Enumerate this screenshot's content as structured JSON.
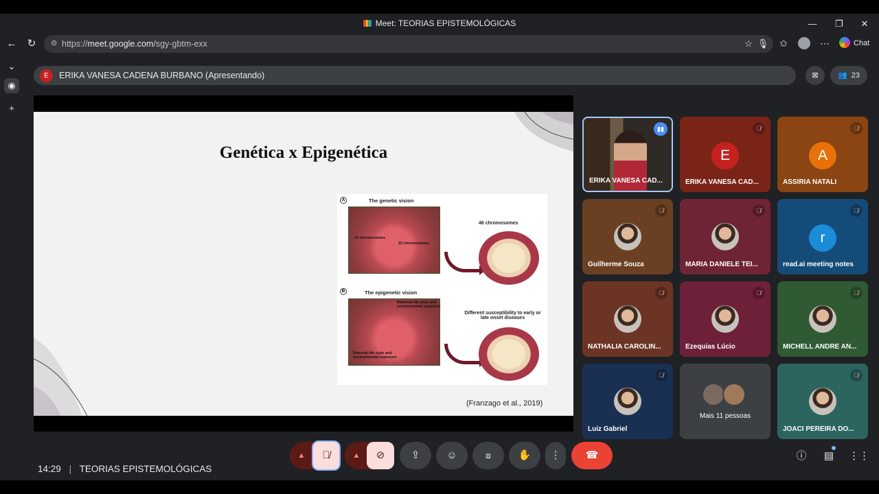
{
  "window": {
    "title": "Meet: TEORIAS EPISTEMOLÓGICAS",
    "minimize": "—",
    "maximize": "❐",
    "close": "✕"
  },
  "toolbar": {
    "url_prefix": "https://",
    "url_host": "meet.google.com",
    "url_path": "/sgy-gbtm-exx",
    "chat_label": "Chat"
  },
  "meet": {
    "presenter": {
      "avatar_letter": "E",
      "text": "ERIKA VANESA CADENA BURBANO (Apresentando)"
    },
    "participant_count": "23",
    "slide": {
      "title": "Genética x Epigenética",
      "panel_a": {
        "letter": "A",
        "heading": "The genetic vision",
        "egg_label_1": "23 chromosomes",
        "egg_label_2": "23 chromosomes",
        "result": "46 chromosomes"
      },
      "panel_b": {
        "letter": "B",
        "heading": "The epigenetic vision",
        "egg_label_1": "Maternal life style and environmental exposure",
        "egg_label_2": "Paternal life style and environmental exposure",
        "result": "Different susceptibility to early or late onset diseases"
      },
      "citation": "(Franzago et al., 2019)"
    },
    "participants": [
      {
        "name": "ERIKA VANESA CAD...",
        "type": "video",
        "speaking": true
      },
      {
        "name": "ERIKA VANESA CAD...",
        "letter": "E",
        "color": "#c5221f",
        "bg": "#7a2418"
      },
      {
        "name": "ASSIRIA NATALI",
        "letter": "A",
        "color": "#e8710a",
        "bg": "#8a4512"
      },
      {
        "name": "Guilherme Souza",
        "type": "photo",
        "bg": "#6b4022"
      },
      {
        "name": "MARIA DANIELE TEI...",
        "type": "photo",
        "bg": "#6e2434"
      },
      {
        "name": "read.ai meeting notes",
        "letter": "r",
        "color": "#1a8cd8",
        "bg": "#144b78"
      },
      {
        "name": "NATHALIA CAROLIN...",
        "type": "photo",
        "bg": "#6b3424"
      },
      {
        "name": "Ezequias Lúcio",
        "type": "photo",
        "bg": "#6e2038"
      },
      {
        "name": "MICHELL ANDRE AN...",
        "type": "photo",
        "bg": "#2f5a33"
      },
      {
        "name": "Luiz Gabriel",
        "type": "photo",
        "bg": "#1a3052"
      },
      {
        "name": "Mais 11 pessoas",
        "type": "more",
        "bg": "#3c4043"
      },
      {
        "name": "JOACI PEREIRA DO...",
        "type": "photo",
        "bg": "#2c6560"
      }
    ],
    "bottom": {
      "time": "14:29",
      "separator": "|",
      "meeting_name": "TEORIAS EPISTEMOLÓGICAS"
    }
  },
  "colors": {
    "end_call": "#ea4335",
    "muted_btn": "#f9dedc",
    "meet_bg": "#202124"
  }
}
